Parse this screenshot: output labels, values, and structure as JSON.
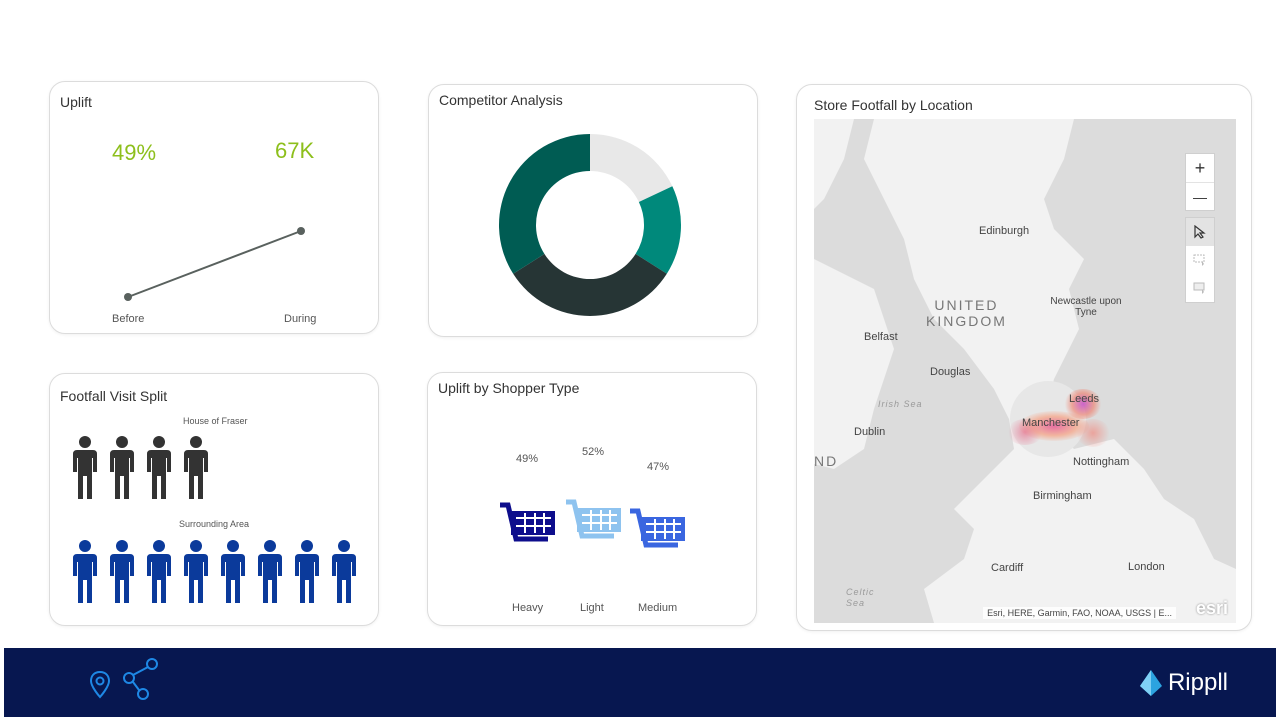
{
  "uplift": {
    "title": "Uplift",
    "kpi_percent": "49%",
    "kpi_count": "67K",
    "x_labels": [
      "Before",
      "During"
    ]
  },
  "competitor": {
    "title": "Competitor Analysis",
    "chart_data": {
      "type": "pie",
      "donut": true,
      "slices": [
        {
          "value": 18,
          "color": "#e8e8e8"
        },
        {
          "value": 16,
          "color": "#00897b"
        },
        {
          "value": 32,
          "color": "#263535"
        },
        {
          "value": 34,
          "color": "#005c53"
        }
      ]
    }
  },
  "footfall_split": {
    "title": "Footfall Visit Split",
    "group1_label": "House of Fraser",
    "group1_count": 4,
    "group1_color": "#333333",
    "group2_label": "Surrounding Area",
    "group2_count": 8,
    "group2_color": "#0b3a9b"
  },
  "shopper_type": {
    "title": "Uplift by Shopper Type",
    "items": [
      {
        "label": "Heavy",
        "value": "49%",
        "color": "#0d0d8c"
      },
      {
        "label": "Light",
        "value": "52%",
        "color": "#8ec3ef"
      },
      {
        "label": "Medium",
        "value": "47%",
        "color": "#3a66e0"
      }
    ]
  },
  "map": {
    "title": "Store Footfall by Location",
    "zoom_in": "+",
    "zoom_out": "—",
    "places": [
      "Edinburgh",
      "Newcastle upon Tyne",
      "Belfast",
      "Douglas",
      "Dublin",
      "Leeds",
      "Manchester",
      "Nottingham",
      "Birmingham",
      "Cardiff",
      "London"
    ],
    "regions": [
      "UNITED KINGDOM",
      "ND"
    ],
    "seas": [
      "Irish Sea",
      "Celtic Sea"
    ],
    "attribution": "Esri, HERE, Garmin, FAO, NOAA, USGS | E...",
    "esri_logo": "esri"
  },
  "footer": {
    "brand": "Rippll",
    "bg": "#071750"
  }
}
